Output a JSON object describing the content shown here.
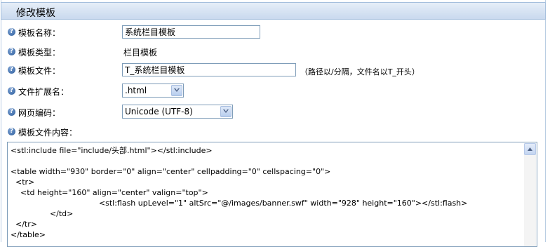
{
  "panel": {
    "title": "修改模板"
  },
  "fields": {
    "name": {
      "label": "模板名称：",
      "value": "系统栏目模板"
    },
    "type": {
      "label": "模板类型：",
      "value": "栏目模板"
    },
    "file": {
      "label": "模板文件：",
      "value": "T_系统栏目模板",
      "hint": "（路径以/分隔，文件名以T_开头）"
    },
    "extension": {
      "label": "文件扩展名：",
      "selected": ".html"
    },
    "encoding": {
      "label": "网页编码：",
      "selected": "Unicode (UTF-8)"
    },
    "content": {
      "label": "模板文件内容：",
      "lines": [
        "<stl:include file=\"include/头部.html\"></stl:include>",
        "",
        "<table width=\"930\" border=\"0\" align=\"center\" cellpadding=\"0\" cellspacing=\"0\">",
        "  <tr>",
        "    <td height=\"160\" align=\"center\" valign=\"top\">",
        "                                    <stl:flash upLevel=\"1\" altSrc=\"@/images/banner.swf\" width=\"928\" height=\"160\"></stl:flash>",
        "                </td>",
        "  </tr>",
        "</table>"
      ]
    }
  },
  "icons": {
    "help": "help-icon",
    "dropdown": "chevron-down-icon",
    "scroll": "scroll-up-arrow"
  },
  "colors": {
    "header_border": "#a5bfdd",
    "header_bg": "#c9d9ee",
    "input_border": "#7f9db9",
    "help_icon": "#2c5c9c"
  }
}
